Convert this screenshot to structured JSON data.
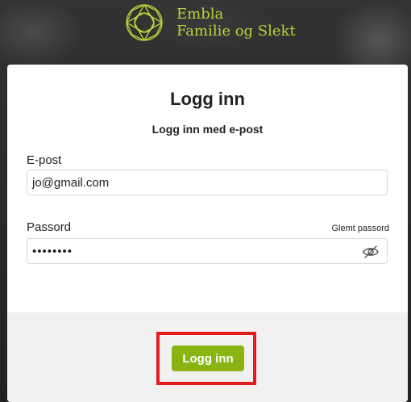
{
  "brand": {
    "line1": "Embla",
    "line2": "Familie og Slekt",
    "accent_color": "#b9d23a"
  },
  "login": {
    "title": "Logg inn",
    "subtitle": "Logg inn med e-post",
    "email_label": "E-post",
    "email_value": "jo@gmail.com",
    "password_label": "Passord",
    "forgot_label": "Glemt passord",
    "password_value": "••••••••",
    "submit_label": "Logg inn",
    "submit_color": "#8ab412",
    "highlight_color": "#e41b1b"
  },
  "icons": {
    "logo": "embla-logo-icon",
    "password_toggle": "eye-slash-icon"
  }
}
